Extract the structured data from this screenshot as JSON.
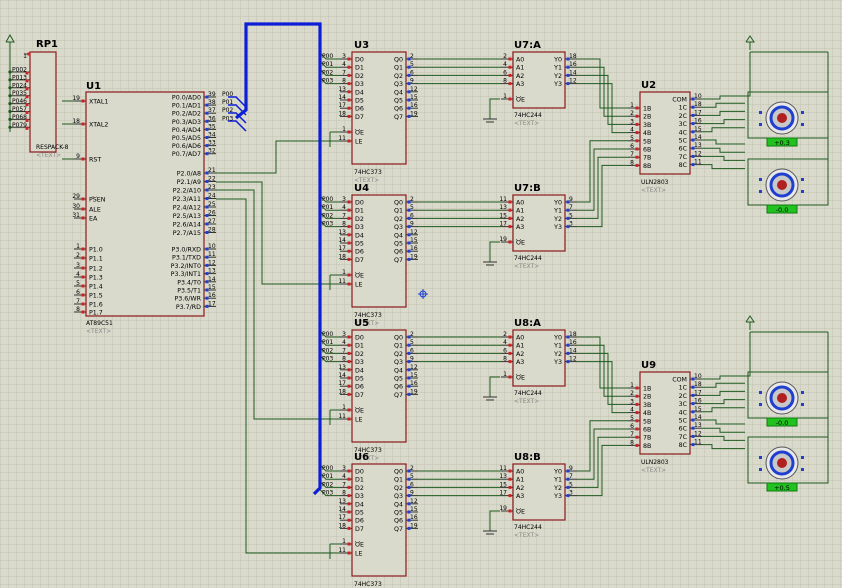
{
  "colors": {
    "background": "#d9d9cc",
    "grid": "#c6c6b4",
    "wire": "#1e5a1e",
    "chip_border": "#8b1a1a",
    "chip_fill": "#d9d9cc",
    "pin_red": "#d02020",
    "pin_blue": "#1f3fd0",
    "bus": "#0d1fd6",
    "label": "#000000",
    "placeholder_text": "#8a8a8a",
    "motor_value_fill": "#21c21f"
  },
  "components": {
    "rp1": {
      "ref": "RP1",
      "part": "RESPACK-8",
      "placeholder": "<TEXT>",
      "pin_number": "1",
      "net_labels": [
        "P00",
        "P01",
        "P02",
        "P03",
        "P04",
        "P05",
        "P06",
        "P07"
      ],
      "pin_numbers": [
        "2",
        "3",
        "4",
        "5",
        "6",
        "7",
        "8",
        "9"
      ]
    },
    "u1": {
      "ref": "U1",
      "part": "AT89C51",
      "placeholder": "<TEXT>",
      "left_pins": [
        {
          "num": "19",
          "name": "XTAL1"
        },
        {
          "num": "18",
          "name": "XTAL2"
        },
        {
          "num": "9",
          "name": "RST"
        },
        {
          "num": "29",
          "name": "PSEN"
        },
        {
          "num": "30",
          "name": "ALE"
        },
        {
          "num": "31",
          "name": "EA"
        },
        {
          "num": "1",
          "name": "P1.0"
        },
        {
          "num": "2",
          "name": "P1.1"
        },
        {
          "num": "3",
          "name": "P1.2"
        },
        {
          "num": "4",
          "name": "P1.3"
        },
        {
          "num": "5",
          "name": "P1.4"
        },
        {
          "num": "6",
          "name": "P1.5"
        },
        {
          "num": "7",
          "name": "P1.6"
        },
        {
          "num": "8",
          "name": "P1.7"
        }
      ],
      "right_pins": [
        {
          "num": "39",
          "name": "P0.0/AD0",
          "net": "P00"
        },
        {
          "num": "38",
          "name": "P0.1/AD1",
          "net": "P01"
        },
        {
          "num": "37",
          "name": "P0.2/AD2",
          "net": "P02"
        },
        {
          "num": "36",
          "name": "P0.3/AD3",
          "net": "P03"
        },
        {
          "num": "35",
          "name": "P0.4/AD4",
          "net": ""
        },
        {
          "num": "34",
          "name": "P0.5/AD5",
          "net": ""
        },
        {
          "num": "33",
          "name": "P0.6/AD6",
          "net": ""
        },
        {
          "num": "32",
          "name": "P0.7/AD7",
          "net": ""
        },
        {
          "num": "21",
          "name": "P2.0/A8",
          "net": ""
        },
        {
          "num": "22",
          "name": "P2.1/A9",
          "net": ""
        },
        {
          "num": "23",
          "name": "P2.2/A10",
          "net": ""
        },
        {
          "num": "24",
          "name": "P2.3/A11",
          "net": ""
        },
        {
          "num": "25",
          "name": "P2.4/A12",
          "net": ""
        },
        {
          "num": "26",
          "name": "P2.5/A13",
          "net": ""
        },
        {
          "num": "27",
          "name": "P2.6/A14",
          "net": ""
        },
        {
          "num": "28",
          "name": "P2.7/A15",
          "net": ""
        },
        {
          "num": "10",
          "name": "P3.0/RXD",
          "net": ""
        },
        {
          "num": "11",
          "name": "P3.1/TXD",
          "net": ""
        },
        {
          "num": "12",
          "name": "P3.2/INT0",
          "net": ""
        },
        {
          "num": "13",
          "name": "P3.3/INT1",
          "net": ""
        },
        {
          "num": "14",
          "name": "P3.4/T0",
          "net": ""
        },
        {
          "num": "15",
          "name": "P3.5/T1",
          "net": ""
        },
        {
          "num": "16",
          "name": "P3.6/WR",
          "net": ""
        },
        {
          "num": "17",
          "name": "P3.7/RD",
          "net": ""
        }
      ]
    },
    "latch_common": {
      "part": "74HC373",
      "placeholder": "<TEXT>",
      "input_nets": [
        "P00",
        "P01",
        "P02",
        "P03"
      ],
      "d_pin_nums": [
        "3",
        "4",
        "7",
        "8",
        "13",
        "14",
        "17",
        "18"
      ],
      "d_pin_names": [
        "D0",
        "D1",
        "D2",
        "D3",
        "D4",
        "D5",
        "D6",
        "D7"
      ],
      "q_pin_nums": [
        "2",
        "5",
        "6",
        "9",
        "12",
        "15",
        "16",
        "19"
      ],
      "q_pin_names": [
        "Q0",
        "Q1",
        "Q2",
        "Q3",
        "Q4",
        "Q5",
        "Q6",
        "Q7"
      ],
      "oe_num": "1",
      "oe_name": "OE",
      "le_num": "11",
      "le_name": "LE"
    },
    "latches": [
      {
        "ref": "U3"
      },
      {
        "ref": "U4"
      },
      {
        "ref": "U5"
      },
      {
        "ref": "U6"
      }
    ],
    "buffer_common": {
      "part": "74HC244",
      "placeholder": "<TEXT>",
      "a_names": [
        "A0",
        "A1",
        "A2",
        "A3"
      ],
      "y_names": [
        "Y0",
        "Y1",
        "Y2",
        "Y3"
      ],
      "oe_name": "OE"
    },
    "buffers": [
      {
        "ref": "U7:A",
        "a_nums": [
          "2",
          "4",
          "6",
          "8"
        ],
        "y_nums": [
          "18",
          "16",
          "14",
          "12"
        ],
        "oe_num": "1"
      },
      {
        "ref": "U7:B",
        "a_nums": [
          "11",
          "13",
          "15",
          "17"
        ],
        "y_nums": [
          "9",
          "7",
          "5",
          "3"
        ],
        "oe_num": "19"
      },
      {
        "ref": "U8:A",
        "a_nums": [
          "2",
          "4",
          "6",
          "8"
        ],
        "y_nums": [
          "18",
          "16",
          "14",
          "12"
        ],
        "oe_num": "1"
      },
      {
        "ref": "U8:B",
        "a_nums": [
          "11",
          "13",
          "15",
          "17"
        ],
        "y_nums": [
          "9",
          "7",
          "5",
          "3"
        ],
        "oe_num": "19"
      }
    ],
    "driver_common": {
      "part": "ULN2803",
      "placeholder": "<TEXT>",
      "in_names": [
        "1B",
        "2B",
        "3B",
        "4B",
        "5B",
        "6B",
        "7B",
        "8B"
      ],
      "in_nums": [
        "1",
        "2",
        "3",
        "4",
        "5",
        "6",
        "7",
        "8"
      ],
      "out_names": [
        "COM",
        "1C",
        "2C",
        "3C",
        "4C",
        "5C",
        "6C",
        "7C",
        "8C"
      ],
      "out_nums": [
        "10",
        "18",
        "17",
        "16",
        "15",
        "14",
        "13",
        "12",
        "11"
      ]
    },
    "drivers": [
      {
        "ref": "U2"
      },
      {
        "ref": "U9"
      }
    ],
    "motors": [
      {
        "value": "+0.3"
      },
      {
        "value": "-0.0"
      },
      {
        "value": "-0.0"
      },
      {
        "value": "+0.5"
      }
    ]
  }
}
